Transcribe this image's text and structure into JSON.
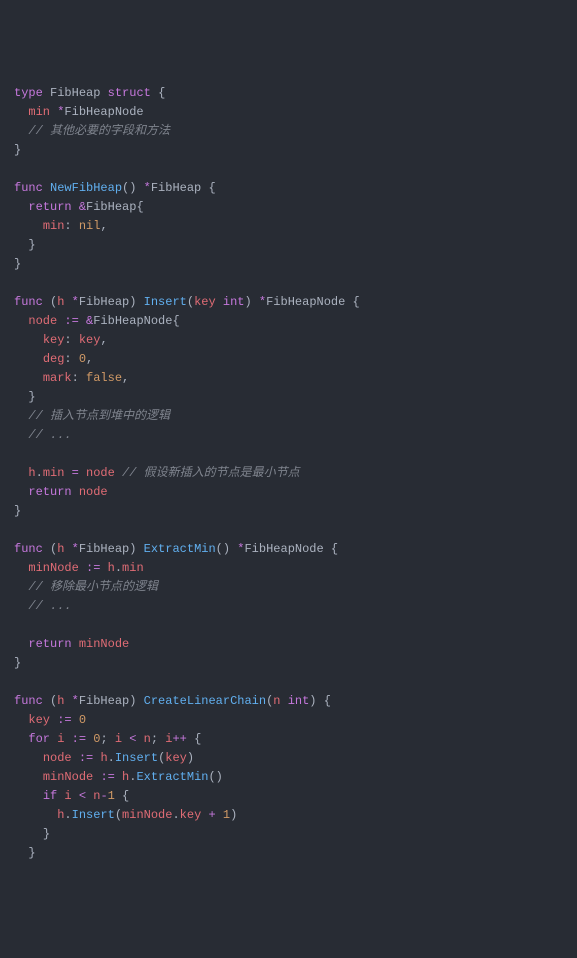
{
  "code": {
    "lines": [
      {
        "indent": 0,
        "tokens": [
          {
            "c": "tok-keyword",
            "t": "type"
          },
          {
            "c": "tok-plain",
            "t": " "
          },
          {
            "c": "tok-type",
            "t": "FibHeap"
          },
          {
            "c": "tok-plain",
            "t": " "
          },
          {
            "c": "tok-keyword",
            "t": "struct"
          },
          {
            "c": "tok-plain",
            "t": " "
          },
          {
            "c": "tok-brace",
            "t": "{"
          }
        ]
      },
      {
        "indent": 1,
        "tokens": [
          {
            "c": "tok-field",
            "t": "min"
          },
          {
            "c": "tok-plain",
            "t": " "
          },
          {
            "c": "tok-op",
            "t": "*"
          },
          {
            "c": "tok-type",
            "t": "FibHeapNode"
          }
        ]
      },
      {
        "indent": 1,
        "tokens": [
          {
            "c": "tok-comment",
            "t": "// 其他必要的字段和方法"
          }
        ]
      },
      {
        "indent": 0,
        "tokens": [
          {
            "c": "tok-brace",
            "t": "}"
          }
        ]
      },
      {
        "indent": 0,
        "tokens": []
      },
      {
        "indent": 0,
        "tokens": [
          {
            "c": "tok-keyword",
            "t": "func"
          },
          {
            "c": "tok-plain",
            "t": " "
          },
          {
            "c": "tok-func",
            "t": "NewFibHeap"
          },
          {
            "c": "tok-brace",
            "t": "()"
          },
          {
            "c": "tok-plain",
            "t": " "
          },
          {
            "c": "tok-op",
            "t": "*"
          },
          {
            "c": "tok-type",
            "t": "FibHeap"
          },
          {
            "c": "tok-plain",
            "t": " "
          },
          {
            "c": "tok-brace",
            "t": "{"
          }
        ]
      },
      {
        "indent": 1,
        "tokens": [
          {
            "c": "tok-keyword",
            "t": "return"
          },
          {
            "c": "tok-plain",
            "t": " "
          },
          {
            "c": "tok-op",
            "t": "&"
          },
          {
            "c": "tok-type",
            "t": "FibHeap"
          },
          {
            "c": "tok-brace",
            "t": "{"
          }
        ]
      },
      {
        "indent": 2,
        "tokens": [
          {
            "c": "tok-field",
            "t": "min"
          },
          {
            "c": "tok-punc",
            "t": ":"
          },
          {
            "c": "tok-plain",
            "t": " "
          },
          {
            "c": "tok-literal",
            "t": "nil"
          },
          {
            "c": "tok-punc",
            "t": ","
          }
        ]
      },
      {
        "indent": 1,
        "tokens": [
          {
            "c": "tok-brace",
            "t": "}"
          }
        ]
      },
      {
        "indent": 0,
        "tokens": [
          {
            "c": "tok-brace",
            "t": "}"
          }
        ]
      },
      {
        "indent": 0,
        "tokens": []
      },
      {
        "indent": 0,
        "tokens": [
          {
            "c": "tok-keyword",
            "t": "func"
          },
          {
            "c": "tok-plain",
            "t": " "
          },
          {
            "c": "tok-brace",
            "t": "("
          },
          {
            "c": "tok-var",
            "t": "h"
          },
          {
            "c": "tok-plain",
            "t": " "
          },
          {
            "c": "tok-op",
            "t": "*"
          },
          {
            "c": "tok-type",
            "t": "FibHeap"
          },
          {
            "c": "tok-brace",
            "t": ")"
          },
          {
            "c": "tok-plain",
            "t": " "
          },
          {
            "c": "tok-func",
            "t": "Insert"
          },
          {
            "c": "tok-brace",
            "t": "("
          },
          {
            "c": "tok-var",
            "t": "key"
          },
          {
            "c": "tok-plain",
            "t": " "
          },
          {
            "c": "tok-keyword",
            "t": "int"
          },
          {
            "c": "tok-brace",
            "t": ")"
          },
          {
            "c": "tok-plain",
            "t": " "
          },
          {
            "c": "tok-op",
            "t": "*"
          },
          {
            "c": "tok-type",
            "t": "FibHeapNode"
          },
          {
            "c": "tok-plain",
            "t": " "
          },
          {
            "c": "tok-brace",
            "t": "{"
          }
        ]
      },
      {
        "indent": 1,
        "tokens": [
          {
            "c": "tok-var",
            "t": "node"
          },
          {
            "c": "tok-plain",
            "t": " "
          },
          {
            "c": "tok-op",
            "t": ":="
          },
          {
            "c": "tok-plain",
            "t": " "
          },
          {
            "c": "tok-op",
            "t": "&"
          },
          {
            "c": "tok-type",
            "t": "FibHeapNode"
          },
          {
            "c": "tok-brace",
            "t": "{"
          }
        ]
      },
      {
        "indent": 2,
        "tokens": [
          {
            "c": "tok-field",
            "t": "key"
          },
          {
            "c": "tok-punc",
            "t": ":"
          },
          {
            "c": "tok-plain",
            "t": " "
          },
          {
            "c": "tok-var",
            "t": "key"
          },
          {
            "c": "tok-punc",
            "t": ","
          }
        ]
      },
      {
        "indent": 2,
        "tokens": [
          {
            "c": "tok-field",
            "t": "deg"
          },
          {
            "c": "tok-punc",
            "t": ":"
          },
          {
            "c": "tok-plain",
            "t": " "
          },
          {
            "c": "tok-literal",
            "t": "0"
          },
          {
            "c": "tok-punc",
            "t": ","
          }
        ]
      },
      {
        "indent": 2,
        "tokens": [
          {
            "c": "tok-field",
            "t": "mark"
          },
          {
            "c": "tok-punc",
            "t": ":"
          },
          {
            "c": "tok-plain",
            "t": " "
          },
          {
            "c": "tok-literal",
            "t": "false"
          },
          {
            "c": "tok-punc",
            "t": ","
          }
        ]
      },
      {
        "indent": 1,
        "tokens": [
          {
            "c": "tok-brace",
            "t": "}"
          }
        ]
      },
      {
        "indent": 1,
        "tokens": [
          {
            "c": "tok-comment",
            "t": "// 插入节点到堆中的逻辑"
          }
        ]
      },
      {
        "indent": 1,
        "tokens": [
          {
            "c": "tok-comment",
            "t": "// ..."
          }
        ]
      },
      {
        "indent": 0,
        "tokens": []
      },
      {
        "indent": 1,
        "tokens": [
          {
            "c": "tok-var",
            "t": "h"
          },
          {
            "c": "tok-punc",
            "t": "."
          },
          {
            "c": "tok-field",
            "t": "min"
          },
          {
            "c": "tok-plain",
            "t": " "
          },
          {
            "c": "tok-op",
            "t": "="
          },
          {
            "c": "tok-plain",
            "t": " "
          },
          {
            "c": "tok-var",
            "t": "node"
          },
          {
            "c": "tok-plain",
            "t": " "
          },
          {
            "c": "tok-comment",
            "t": "// 假设新插入的节点是最小节点"
          }
        ]
      },
      {
        "indent": 1,
        "tokens": [
          {
            "c": "tok-keyword",
            "t": "return"
          },
          {
            "c": "tok-plain",
            "t": " "
          },
          {
            "c": "tok-var",
            "t": "node"
          }
        ]
      },
      {
        "indent": 0,
        "tokens": [
          {
            "c": "tok-brace",
            "t": "}"
          }
        ]
      },
      {
        "indent": 0,
        "tokens": []
      },
      {
        "indent": 0,
        "tokens": [
          {
            "c": "tok-keyword",
            "t": "func"
          },
          {
            "c": "tok-plain",
            "t": " "
          },
          {
            "c": "tok-brace",
            "t": "("
          },
          {
            "c": "tok-var",
            "t": "h"
          },
          {
            "c": "tok-plain",
            "t": " "
          },
          {
            "c": "tok-op",
            "t": "*"
          },
          {
            "c": "tok-type",
            "t": "FibHeap"
          },
          {
            "c": "tok-brace",
            "t": ")"
          },
          {
            "c": "tok-plain",
            "t": " "
          },
          {
            "c": "tok-func",
            "t": "ExtractMin"
          },
          {
            "c": "tok-brace",
            "t": "()"
          },
          {
            "c": "tok-plain",
            "t": " "
          },
          {
            "c": "tok-op",
            "t": "*"
          },
          {
            "c": "tok-type",
            "t": "FibHeapNode"
          },
          {
            "c": "tok-plain",
            "t": " "
          },
          {
            "c": "tok-brace",
            "t": "{"
          }
        ]
      },
      {
        "indent": 1,
        "tokens": [
          {
            "c": "tok-var",
            "t": "minNode"
          },
          {
            "c": "tok-plain",
            "t": " "
          },
          {
            "c": "tok-op",
            "t": ":="
          },
          {
            "c": "tok-plain",
            "t": " "
          },
          {
            "c": "tok-var",
            "t": "h"
          },
          {
            "c": "tok-punc",
            "t": "."
          },
          {
            "c": "tok-field",
            "t": "min"
          }
        ]
      },
      {
        "indent": 1,
        "tokens": [
          {
            "c": "tok-comment",
            "t": "// 移除最小节点的逻辑"
          }
        ]
      },
      {
        "indent": 1,
        "tokens": [
          {
            "c": "tok-comment",
            "t": "// ..."
          }
        ]
      },
      {
        "indent": 0,
        "tokens": []
      },
      {
        "indent": 1,
        "tokens": [
          {
            "c": "tok-keyword",
            "t": "return"
          },
          {
            "c": "tok-plain",
            "t": " "
          },
          {
            "c": "tok-var",
            "t": "minNode"
          }
        ]
      },
      {
        "indent": 0,
        "tokens": [
          {
            "c": "tok-brace",
            "t": "}"
          }
        ]
      },
      {
        "indent": 0,
        "tokens": []
      },
      {
        "indent": 0,
        "tokens": [
          {
            "c": "tok-keyword",
            "t": "func"
          },
          {
            "c": "tok-plain",
            "t": " "
          },
          {
            "c": "tok-brace",
            "t": "("
          },
          {
            "c": "tok-var",
            "t": "h"
          },
          {
            "c": "tok-plain",
            "t": " "
          },
          {
            "c": "tok-op",
            "t": "*"
          },
          {
            "c": "tok-type",
            "t": "FibHeap"
          },
          {
            "c": "tok-brace",
            "t": ")"
          },
          {
            "c": "tok-plain",
            "t": " "
          },
          {
            "c": "tok-func",
            "t": "CreateLinearChain"
          },
          {
            "c": "tok-brace",
            "t": "("
          },
          {
            "c": "tok-var",
            "t": "n"
          },
          {
            "c": "tok-plain",
            "t": " "
          },
          {
            "c": "tok-keyword",
            "t": "int"
          },
          {
            "c": "tok-brace",
            "t": ")"
          },
          {
            "c": "tok-plain",
            "t": " "
          },
          {
            "c": "tok-brace",
            "t": "{"
          }
        ]
      },
      {
        "indent": 1,
        "tokens": [
          {
            "c": "tok-var",
            "t": "key"
          },
          {
            "c": "tok-plain",
            "t": " "
          },
          {
            "c": "tok-op",
            "t": ":="
          },
          {
            "c": "tok-plain",
            "t": " "
          },
          {
            "c": "tok-literal",
            "t": "0"
          }
        ]
      },
      {
        "indent": 1,
        "tokens": [
          {
            "c": "tok-keyword",
            "t": "for"
          },
          {
            "c": "tok-plain",
            "t": " "
          },
          {
            "c": "tok-var",
            "t": "i"
          },
          {
            "c": "tok-plain",
            "t": " "
          },
          {
            "c": "tok-op",
            "t": ":="
          },
          {
            "c": "tok-plain",
            "t": " "
          },
          {
            "c": "tok-literal",
            "t": "0"
          },
          {
            "c": "tok-punc",
            "t": ";"
          },
          {
            "c": "tok-plain",
            "t": " "
          },
          {
            "c": "tok-var",
            "t": "i"
          },
          {
            "c": "tok-plain",
            "t": " "
          },
          {
            "c": "tok-op",
            "t": "<"
          },
          {
            "c": "tok-plain",
            "t": " "
          },
          {
            "c": "tok-var",
            "t": "n"
          },
          {
            "c": "tok-punc",
            "t": ";"
          },
          {
            "c": "tok-plain",
            "t": " "
          },
          {
            "c": "tok-var",
            "t": "i"
          },
          {
            "c": "tok-op",
            "t": "++"
          },
          {
            "c": "tok-plain",
            "t": " "
          },
          {
            "c": "tok-brace",
            "t": "{"
          }
        ]
      },
      {
        "indent": 2,
        "tokens": [
          {
            "c": "tok-var",
            "t": "node"
          },
          {
            "c": "tok-plain",
            "t": " "
          },
          {
            "c": "tok-op",
            "t": ":="
          },
          {
            "c": "tok-plain",
            "t": " "
          },
          {
            "c": "tok-var",
            "t": "h"
          },
          {
            "c": "tok-punc",
            "t": "."
          },
          {
            "c": "tok-func",
            "t": "Insert"
          },
          {
            "c": "tok-brace",
            "t": "("
          },
          {
            "c": "tok-var",
            "t": "key"
          },
          {
            "c": "tok-brace",
            "t": ")"
          }
        ]
      },
      {
        "indent": 2,
        "tokens": [
          {
            "c": "tok-var",
            "t": "minNode"
          },
          {
            "c": "tok-plain",
            "t": " "
          },
          {
            "c": "tok-op",
            "t": ":="
          },
          {
            "c": "tok-plain",
            "t": " "
          },
          {
            "c": "tok-var",
            "t": "h"
          },
          {
            "c": "tok-punc",
            "t": "."
          },
          {
            "c": "tok-func",
            "t": "ExtractMin"
          },
          {
            "c": "tok-brace",
            "t": "()"
          }
        ]
      },
      {
        "indent": 2,
        "tokens": [
          {
            "c": "tok-keyword",
            "t": "if"
          },
          {
            "c": "tok-plain",
            "t": " "
          },
          {
            "c": "tok-var",
            "t": "i"
          },
          {
            "c": "tok-plain",
            "t": " "
          },
          {
            "c": "tok-op",
            "t": "<"
          },
          {
            "c": "tok-plain",
            "t": " "
          },
          {
            "c": "tok-var",
            "t": "n"
          },
          {
            "c": "tok-op",
            "t": "-"
          },
          {
            "c": "tok-literal",
            "t": "1"
          },
          {
            "c": "tok-plain",
            "t": " "
          },
          {
            "c": "tok-brace",
            "t": "{"
          }
        ]
      },
      {
        "indent": 3,
        "tokens": [
          {
            "c": "tok-var",
            "t": "h"
          },
          {
            "c": "tok-punc",
            "t": "."
          },
          {
            "c": "tok-func",
            "t": "Insert"
          },
          {
            "c": "tok-brace",
            "t": "("
          },
          {
            "c": "tok-var",
            "t": "minNode"
          },
          {
            "c": "tok-punc",
            "t": "."
          },
          {
            "c": "tok-field",
            "t": "key"
          },
          {
            "c": "tok-plain",
            "t": " "
          },
          {
            "c": "tok-op",
            "t": "+"
          },
          {
            "c": "tok-plain",
            "t": " "
          },
          {
            "c": "tok-literal",
            "t": "1"
          },
          {
            "c": "tok-brace",
            "t": ")"
          }
        ]
      },
      {
        "indent": 2,
        "tokens": [
          {
            "c": "tok-brace",
            "t": "}"
          }
        ]
      },
      {
        "indent": 1,
        "tokens": [
          {
            "c": "tok-brace",
            "t": "}"
          }
        ]
      }
    ],
    "indent_unit": "  "
  }
}
